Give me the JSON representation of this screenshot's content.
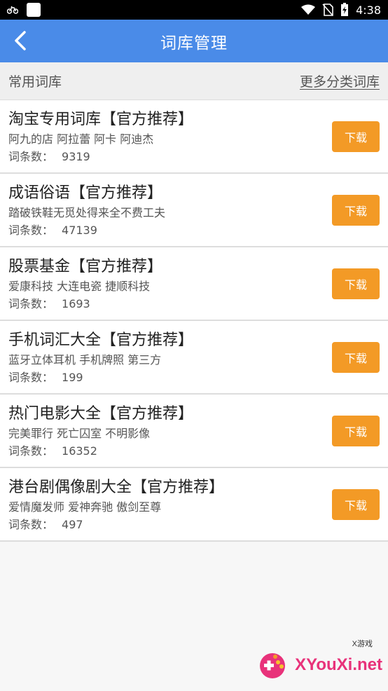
{
  "statusbar": {
    "time": "4:38"
  },
  "appbar": {
    "title": "词库管理"
  },
  "section": {
    "left_label": "常用词库",
    "right_link": "更多分类词库"
  },
  "count_label": "词条数：",
  "download_label": "下载",
  "items": [
    {
      "name": "淘宝专用词库【官方推荐】",
      "desc": "阿九的店 阿拉蕾 阿卡 阿迪杰",
      "count": "9319"
    },
    {
      "name": "成语俗语【官方推荐】",
      "desc": "踏破铁鞋无觅处得来全不费工夫",
      "count": "47139"
    },
    {
      "name": "股票基金【官方推荐】",
      "desc": "爱康科技 大连电瓷 捷顺科技",
      "count": "1693"
    },
    {
      "name": "手机词汇大全【官方推荐】",
      "desc": "蓝牙立体耳机 手机牌照 第三方",
      "count": "199"
    },
    {
      "name": "热门电影大全【官方推荐】",
      "desc": "完美罪行 死亡囚室 不明影像",
      "count": "16352"
    },
    {
      "name": "港台剧偶像剧大全【官方推荐】",
      "desc": "爱情魔发师 爱神奔驰 傲剑至尊",
      "count": "497"
    }
  ],
  "watermark": {
    "text": "XYouXi.net",
    "small": "X游戏"
  }
}
